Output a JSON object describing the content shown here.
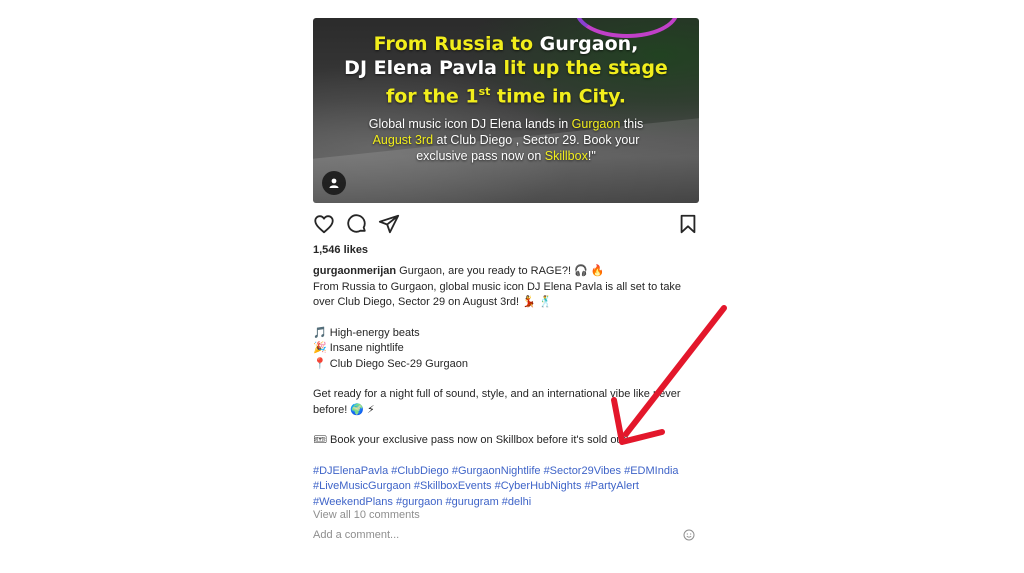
{
  "media": {
    "headline_l1a": "From Russia to ",
    "headline_l1b": "Gurgaon,",
    "headline_l2a": "DJ Elena Pavla ",
    "headline_l2b": "lit up the stage",
    "headline_l3a": "for the 1",
    "headline_l3sup": "st",
    "headline_l3b": " time in City.",
    "sub_l1a": "Global music icon DJ Elena lands in ",
    "sub_l1b": "Gurgaon",
    "sub_l1c": " this",
    "sub_l2a": "August 3rd",
    "sub_l2b": " at Club Diego , Sector 29. Book your",
    "sub_l3a": "exclusive pass now on ",
    "sub_l3b": "Skillbox",
    "sub_l3c": "!\""
  },
  "actions": {
    "icons": [
      "heart-icon",
      "comment-icon",
      "share-icon",
      "bookmark-icon"
    ]
  },
  "likes": "1,546 likes",
  "caption": {
    "username": "gurgaonmerijan",
    "intro": " Gurgaon, are you ready to RAGE?! 🎧 🔥",
    "line2": "From Russia to Gurgaon, global music icon DJ Elena Pavla is all set to take",
    "line3": "over Club Diego, Sector 29 on August 3rd! 💃 🕺",
    "bullet1": "🎵 High-energy beats",
    "bullet2": "🎉 Insane nightlife",
    "bullet3": "📍 Club Diego Sec-29 Gurgaon",
    "line4": "Get ready for a night full of sound, style, and an international vibe like never",
    "line5": "before! 🌍 ⚡",
    "line6": "🎟 Book your exclusive pass now on Skillbox before it's sold out!",
    "hashtags_row1": [
      "#DJElenaPavla",
      "#ClubDiego",
      "#GurgaonNightlife",
      "#Sector29Vibes",
      "#EDMIndia"
    ],
    "hashtags_row2": [
      "#LiveMusicGurgaon",
      "#SkillboxEvents",
      "#CyberHubNights",
      "#PartyAlert"
    ],
    "hashtags_row3": [
      "#WeekendPlans",
      "#gurgaon",
      "#gurugram",
      "#delhi"
    ]
  },
  "comments": {
    "view_all": "View all 10 comments"
  },
  "add_comment": {
    "placeholder": "Add a comment..."
  },
  "colors": {
    "annotation_arrow": "#e3172b",
    "hashtag": "#3f64c8",
    "highlight_yellow": "#f2ee1c"
  }
}
